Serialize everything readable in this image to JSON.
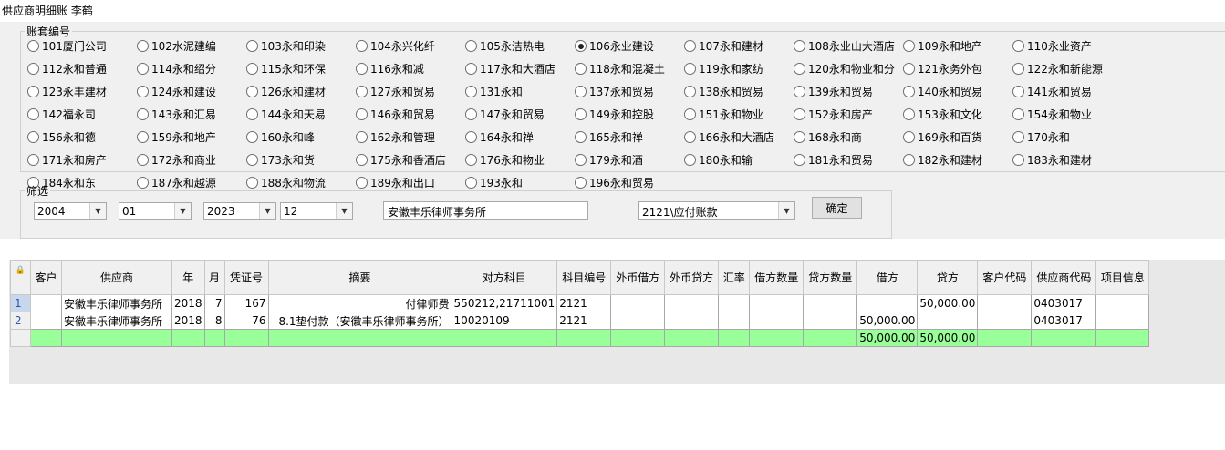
{
  "window": {
    "title": "供应商明细账 李鹤"
  },
  "accountset_group": {
    "legend": "账套编号",
    "options": [
      {
        "label": "101厦门公司",
        "checked": false
      },
      {
        "label": "102水泥建编",
        "checked": false
      },
      {
        "label": "103永和印染",
        "checked": false
      },
      {
        "label": "104永兴化纤",
        "checked": false
      },
      {
        "label": "105永洁热电",
        "checked": false
      },
      {
        "label": "106永业建设",
        "checked": true
      },
      {
        "label": "107永和建材",
        "checked": false
      },
      {
        "label": "108永业山大酒店",
        "checked": false
      },
      {
        "label": "109永和地产",
        "checked": false
      },
      {
        "label": "110永业资产",
        "checked": false
      },
      {
        "label": "112永和普通",
        "checked": false
      },
      {
        "label": "114永和绍分",
        "checked": false
      },
      {
        "label": "115永和环保",
        "checked": false
      },
      {
        "label": "116永和减",
        "checked": false
      },
      {
        "label": "117永和大酒店",
        "checked": false
      },
      {
        "label": "118永和混凝土",
        "checked": false
      },
      {
        "label": "119永和家纺",
        "checked": false
      },
      {
        "label": "120永和物业和分",
        "checked": false
      },
      {
        "label": "121永务外包",
        "checked": false
      },
      {
        "label": "122永和新能源",
        "checked": false
      },
      {
        "label": "123永丰建材",
        "checked": false
      },
      {
        "label": "124永和建设",
        "checked": false
      },
      {
        "label": "126永和建材",
        "checked": false
      },
      {
        "label": "127永和贸易",
        "checked": false
      },
      {
        "label": "131永和",
        "checked": false
      },
      {
        "label": "137永和贸易",
        "checked": false
      },
      {
        "label": "138永和贸易",
        "checked": false
      },
      {
        "label": "139永和贸易",
        "checked": false
      },
      {
        "label": "140永和贸易",
        "checked": false
      },
      {
        "label": "141永和贸易",
        "checked": false
      },
      {
        "label": "142福永司",
        "checked": false
      },
      {
        "label": "143永和汇易",
        "checked": false
      },
      {
        "label": "144永和天易",
        "checked": false
      },
      {
        "label": "146永和贸易",
        "checked": false
      },
      {
        "label": "147永和贸易",
        "checked": false
      },
      {
        "label": "149永和控股",
        "checked": false
      },
      {
        "label": "151永和物业",
        "checked": false
      },
      {
        "label": "152永和房产",
        "checked": false
      },
      {
        "label": "153永和文化",
        "checked": false
      },
      {
        "label": "154永和物业",
        "checked": false
      },
      {
        "label": "156永和德",
        "checked": false
      },
      {
        "label": "159永和地产",
        "checked": false
      },
      {
        "label": "160永和峰",
        "checked": false
      },
      {
        "label": "162永和管理",
        "checked": false
      },
      {
        "label": "164永和禅",
        "checked": false
      },
      {
        "label": "165永和禅",
        "checked": false
      },
      {
        "label": "166永和大酒店",
        "checked": false
      },
      {
        "label": "168永和商",
        "checked": false
      },
      {
        "label": "169永和百货",
        "checked": false
      },
      {
        "label": "170永和",
        "checked": false
      },
      {
        "label": "171永和房产",
        "checked": false
      },
      {
        "label": "172永和商业",
        "checked": false
      },
      {
        "label": "173永和货",
        "checked": false
      },
      {
        "label": "175永和香酒店",
        "checked": false
      },
      {
        "label": "176永和物业",
        "checked": false
      },
      {
        "label": "179永和酒",
        "checked": false
      },
      {
        "label": "180永和输",
        "checked": false
      },
      {
        "label": "181永和贸易",
        "checked": false
      },
      {
        "label": "182永和建材",
        "checked": false
      },
      {
        "label": "183永和建材",
        "checked": false
      },
      {
        "label": "184永和东",
        "checked": false
      },
      {
        "label": "187永和越源",
        "checked": false
      },
      {
        "label": "188永和物流",
        "checked": false
      },
      {
        "label": "189永和出口",
        "checked": false
      },
      {
        "label": "193永和",
        "checked": false
      },
      {
        "label": "196永和贸易",
        "checked": false
      }
    ]
  },
  "filter_group": {
    "legend": "筛选",
    "start_year": "2004",
    "start_month": "01",
    "end_year": "2023",
    "end_month": "12",
    "supplier_name": "安徽丰乐律师事务所",
    "account": "2121\\应付账款",
    "confirm_label": "确定"
  },
  "table": {
    "columns": [
      "客户",
      "供应商",
      "年",
      "月",
      "凭证号",
      "摘要",
      "对方科目",
      "科目编号",
      "外币借方",
      "外币贷方",
      "汇率",
      "借方数量",
      "贷方数量",
      "借方",
      "贷方",
      "客户代码",
      "供应商代码",
      "项目信息"
    ],
    "rows": [
      {
        "row_no": "1",
        "cells": [
          "",
          "安徽丰乐律师事务所",
          "2018",
          "7",
          "167",
          "付律师费",
          "550212,21711001",
          "2121",
          "",
          "",
          "",
          "",
          "",
          "",
          "50,000.00",
          "",
          "0403017",
          ""
        ]
      },
      {
        "row_no": "2",
        "cells": [
          "",
          "安徽丰乐律师事务所",
          "2018",
          "8",
          "76",
          "8.1垫付款（安徽丰乐律师事务所）",
          "10020109",
          "2121",
          "",
          "",
          "",
          "",
          "",
          "50,000.00",
          "",
          "",
          "0403017",
          ""
        ]
      }
    ],
    "total": {
      "cells": [
        "",
        "",
        "",
        "",
        "",
        "",
        "",
        "",
        "",
        "",
        "",
        "",
        "",
        "50,000.00",
        "50,000.00",
        "",
        "",
        ""
      ]
    }
  }
}
